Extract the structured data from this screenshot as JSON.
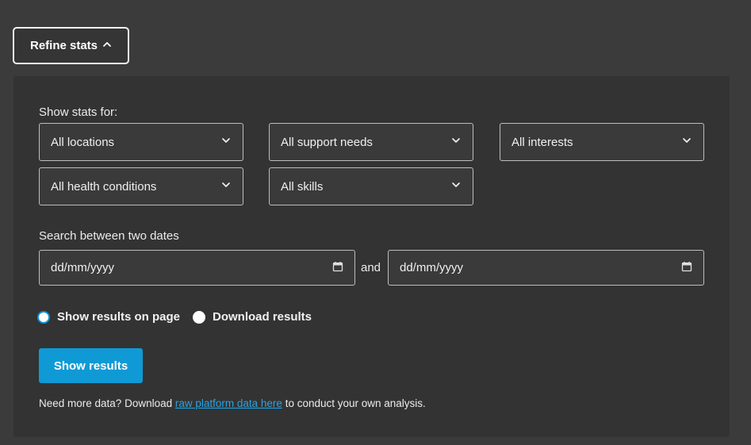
{
  "toggle": {
    "label": "Refine stats"
  },
  "filters": {
    "heading": "Show stats for:",
    "selects": [
      {
        "value": "All locations"
      },
      {
        "value": "All support needs"
      },
      {
        "value": "All interests"
      },
      {
        "value": "All health conditions"
      },
      {
        "value": "All skills"
      }
    ]
  },
  "dates": {
    "heading": "Search between two dates",
    "from_placeholder": "dd/mm/yyyy",
    "to_placeholder": "dd/mm/yyyy",
    "joiner": "and"
  },
  "output": {
    "options": [
      {
        "label": "Show results on page",
        "selected": true
      },
      {
        "label": "Download results",
        "selected": false
      }
    ]
  },
  "submit": {
    "label": "Show results"
  },
  "footer": {
    "prefix": "Need more data? Download ",
    "link_text": "raw platform data here",
    "suffix": " to conduct your own analysis."
  },
  "colors": {
    "accent": "#0f9ad6",
    "link": "#25a4e6",
    "panel": "#333333",
    "background": "#3b3b3b"
  }
}
